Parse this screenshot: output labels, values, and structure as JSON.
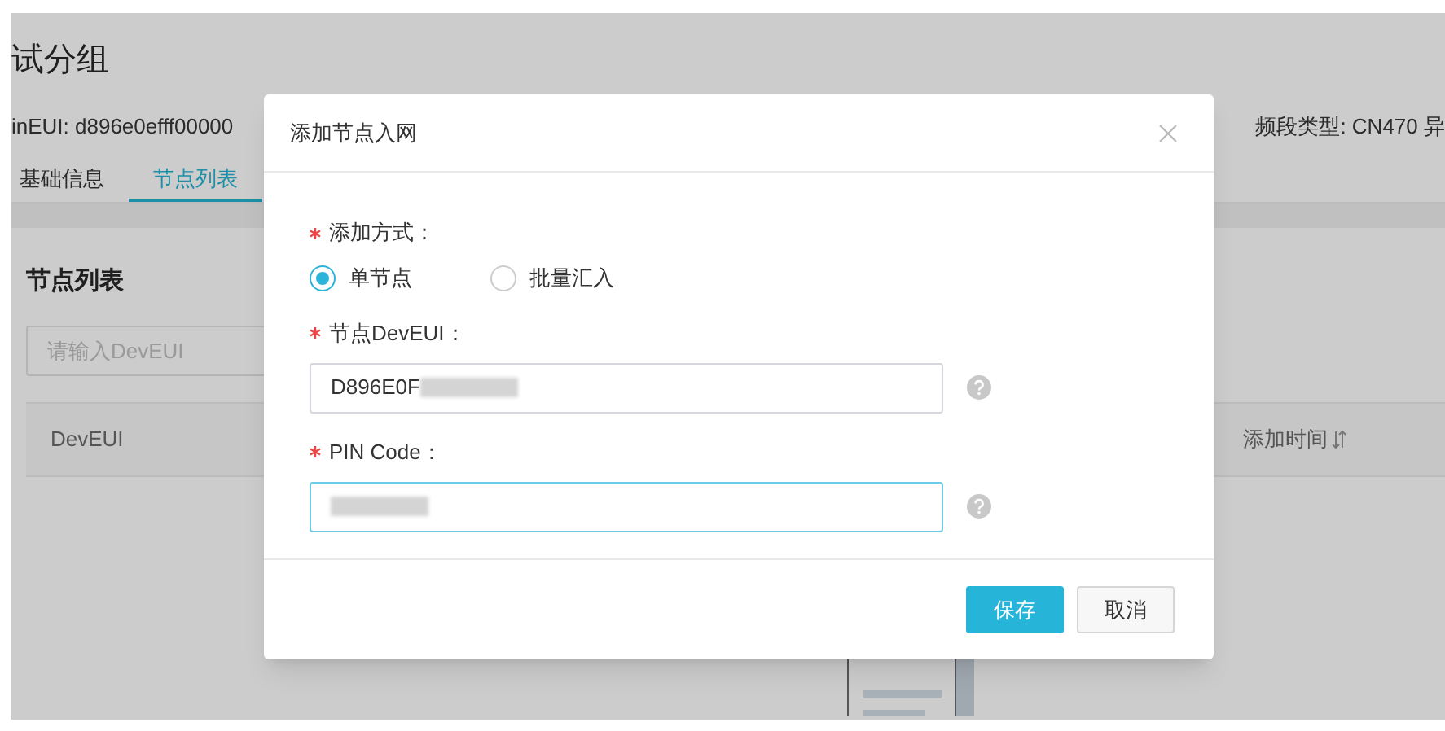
{
  "page": {
    "title": "试分组",
    "meta_left": "inEUI: d896e0efff00000",
    "meta_right": "频段类型: CN470 异",
    "tabs": [
      {
        "label": "基础信息",
        "selected": false
      },
      {
        "label": "节点列表",
        "selected": true
      }
    ],
    "section_title": "节点列表",
    "search": {
      "placeholder": "请输入DevEUI"
    },
    "table": {
      "columns": [
        "DevEUI",
        "添加时间"
      ]
    }
  },
  "dialog": {
    "title": "添加节点入网",
    "fields": [
      {
        "kind": "radio",
        "label": "添加方式：",
        "required": true,
        "options": [
          {
            "label": "单节点",
            "selected": true
          },
          {
            "label": "批量汇入",
            "selected": false
          }
        ]
      },
      {
        "kind": "input",
        "label": "节点DevEUI：",
        "required": true,
        "value": "D896E0F",
        "redacted": true,
        "focused": false
      },
      {
        "kind": "input",
        "label": "PIN Code：",
        "required": true,
        "redacted": true,
        "focused": true
      }
    ],
    "buttons": [
      {
        "label": "保存",
        "kind": "primary"
      },
      {
        "label": "取消",
        "kind": "default"
      }
    ]
  }
}
